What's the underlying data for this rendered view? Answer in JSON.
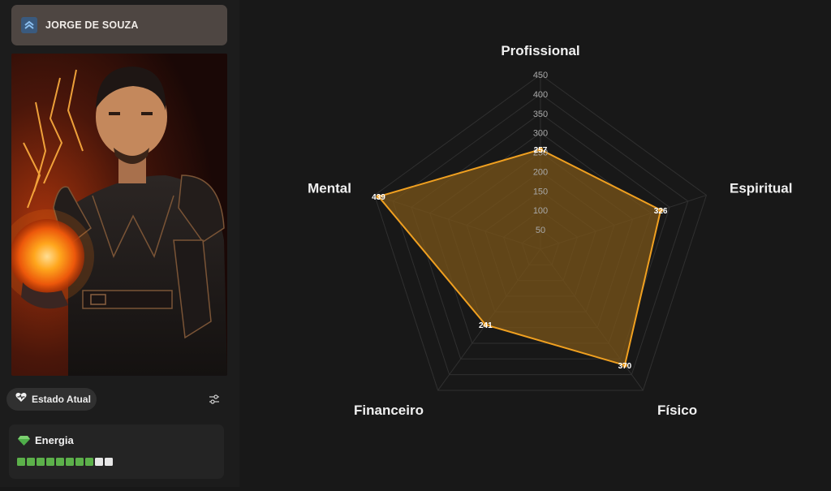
{
  "profile": {
    "name": "JORGE DE SOUZA",
    "rank_icon": "double-chevron-up-icon",
    "portrait": "armored-warrior-with-fireball-portrait"
  },
  "state_button": {
    "label": "Estado Atual",
    "icon": "heart-pulse-icon"
  },
  "settings_icon": "sliders-icon",
  "energy": {
    "label": "Energia",
    "icon": "gem-icon",
    "segments_total": 10,
    "segments_filled": 8,
    "filled_color": "#5cb04a",
    "empty_color": "#e6e6e6"
  },
  "chart_data": {
    "type": "radar",
    "axes": [
      "Profissional",
      "Espiritual",
      "Físico",
      "Financeiro",
      "Mental"
    ],
    "values": [
      257,
      326,
      370,
      241,
      439
    ],
    "value_labels": [
      "257",
      "326",
      "370",
      "241",
      "439"
    ],
    "rmax": 450,
    "ticks": [
      50,
      100,
      150,
      200,
      250,
      300,
      350,
      400,
      450
    ],
    "tick_labels": [
      "50",
      "100",
      "150",
      "200",
      "250",
      "300",
      "350",
      "400",
      "450"
    ],
    "line_color": "#f0a020",
    "fill_color": "#7a5418"
  }
}
